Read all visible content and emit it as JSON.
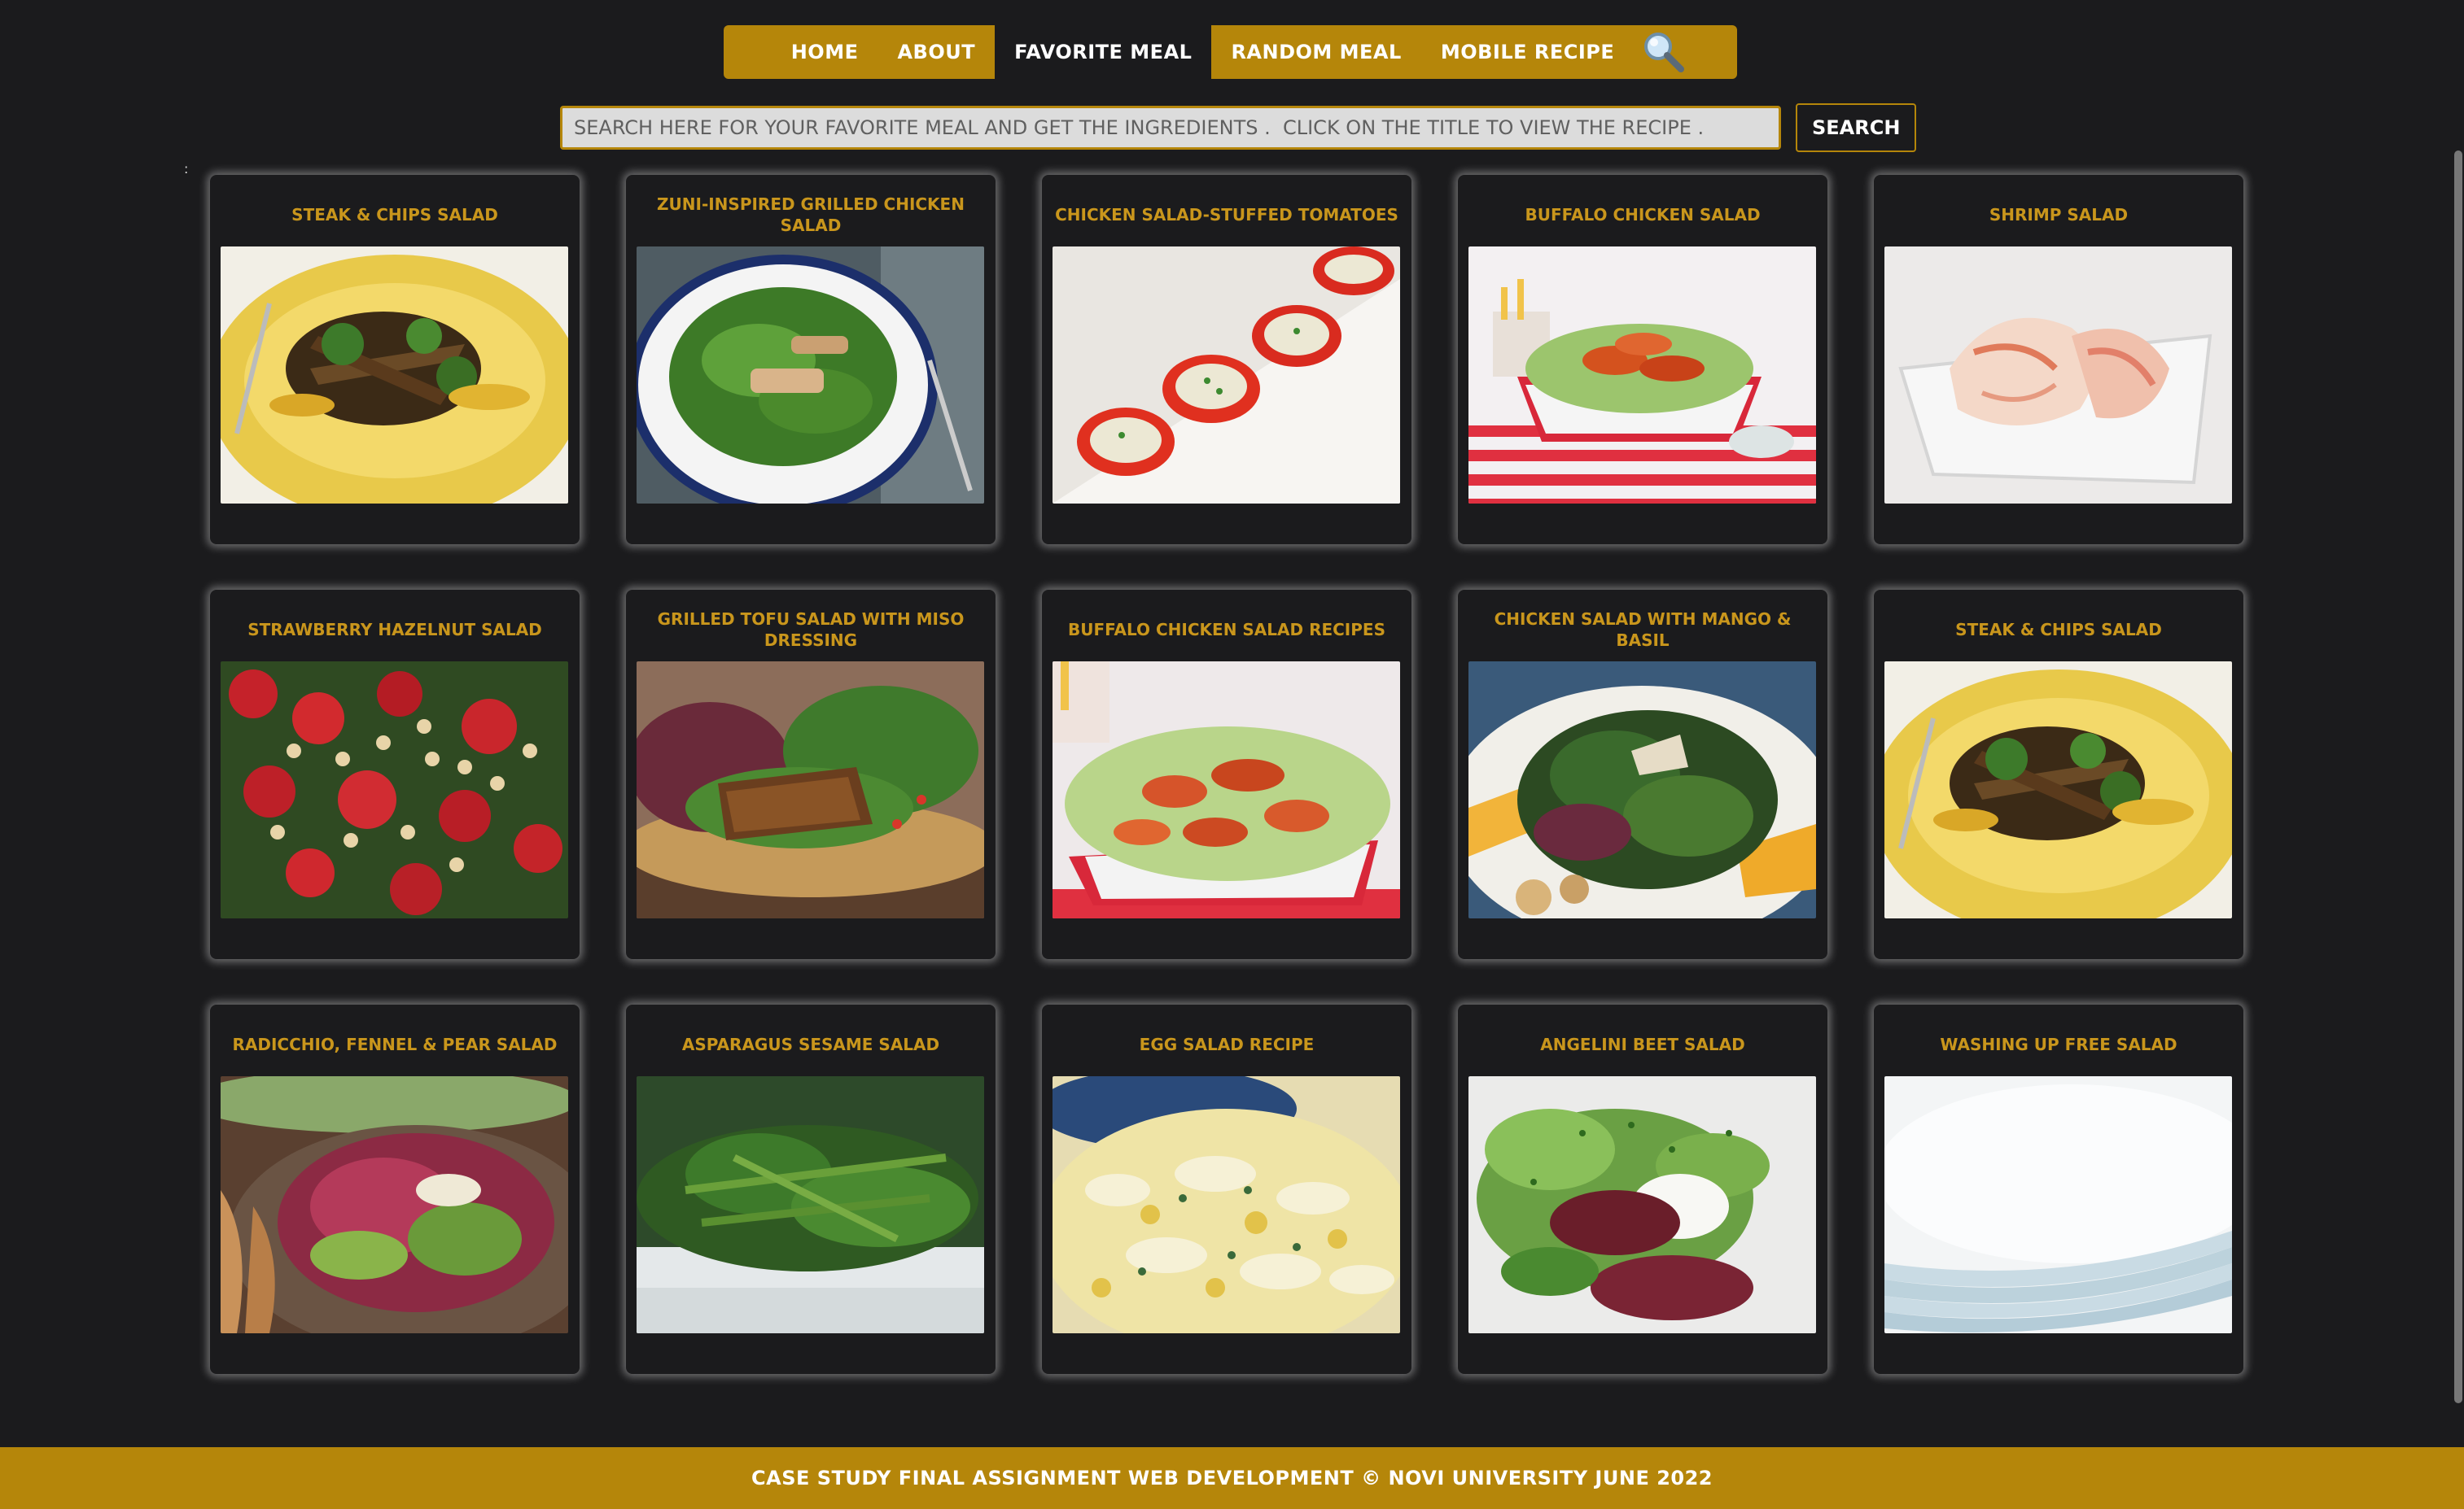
{
  "nav": {
    "items": [
      {
        "label": "HOME",
        "active": false
      },
      {
        "label": "ABOUT",
        "active": false
      },
      {
        "label": "FAVORITE MEAL",
        "active": true
      },
      {
        "label": "RANDOM MEAL",
        "active": false
      },
      {
        "label": "MOBILE RECIPE",
        "active": false
      }
    ],
    "search_icon": "magnifier-icon"
  },
  "search": {
    "placeholder": "SEARCH HERE FOR YOUR FAVORITE MEAL AND GET THE INGREDIENTS .  CLICK ON THE TITLE TO VIEW THE RECIPE .",
    "value": "",
    "button_label": "SEARCH"
  },
  "stray_mark": ":",
  "meals": [
    {
      "title": "STEAK & CHIPS SALAD"
    },
    {
      "title": "ZUNI-INSPIRED GRILLED CHICKEN SALAD"
    },
    {
      "title": "CHICKEN SALAD-STUFFED TOMATOES"
    },
    {
      "title": "BUFFALO CHICKEN SALAD"
    },
    {
      "title": "SHRIMP SALAD"
    },
    {
      "title": "STRAWBERRY HAZELNUT SALAD"
    },
    {
      "title": "GRILLED TOFU SALAD WITH MISO DRESSING"
    },
    {
      "title": "BUFFALO CHICKEN SALAD RECIPES"
    },
    {
      "title": "CHICKEN SALAD WITH MANGO & BASIL"
    },
    {
      "title": "STEAK & CHIPS SALAD"
    },
    {
      "title": "RADICCHIO, FENNEL & PEAR SALAD"
    },
    {
      "title": "ASPARAGUS SESAME SALAD"
    },
    {
      "title": "EGG SALAD RECIPE"
    },
    {
      "title": "ANGELINI BEET SALAD"
    },
    {
      "title": "WASHING UP FREE SALAD"
    }
  ],
  "footer": {
    "text": "CASE STUDY FINAL ASSIGNMENT WEB DEVELOPMENT © NOVI UNIVERSITY JUNE 2022"
  },
  "colors": {
    "background": "#1b1b1d",
    "accent": "#b5860a",
    "title": "#c9961c",
    "text": "#ffffff"
  }
}
